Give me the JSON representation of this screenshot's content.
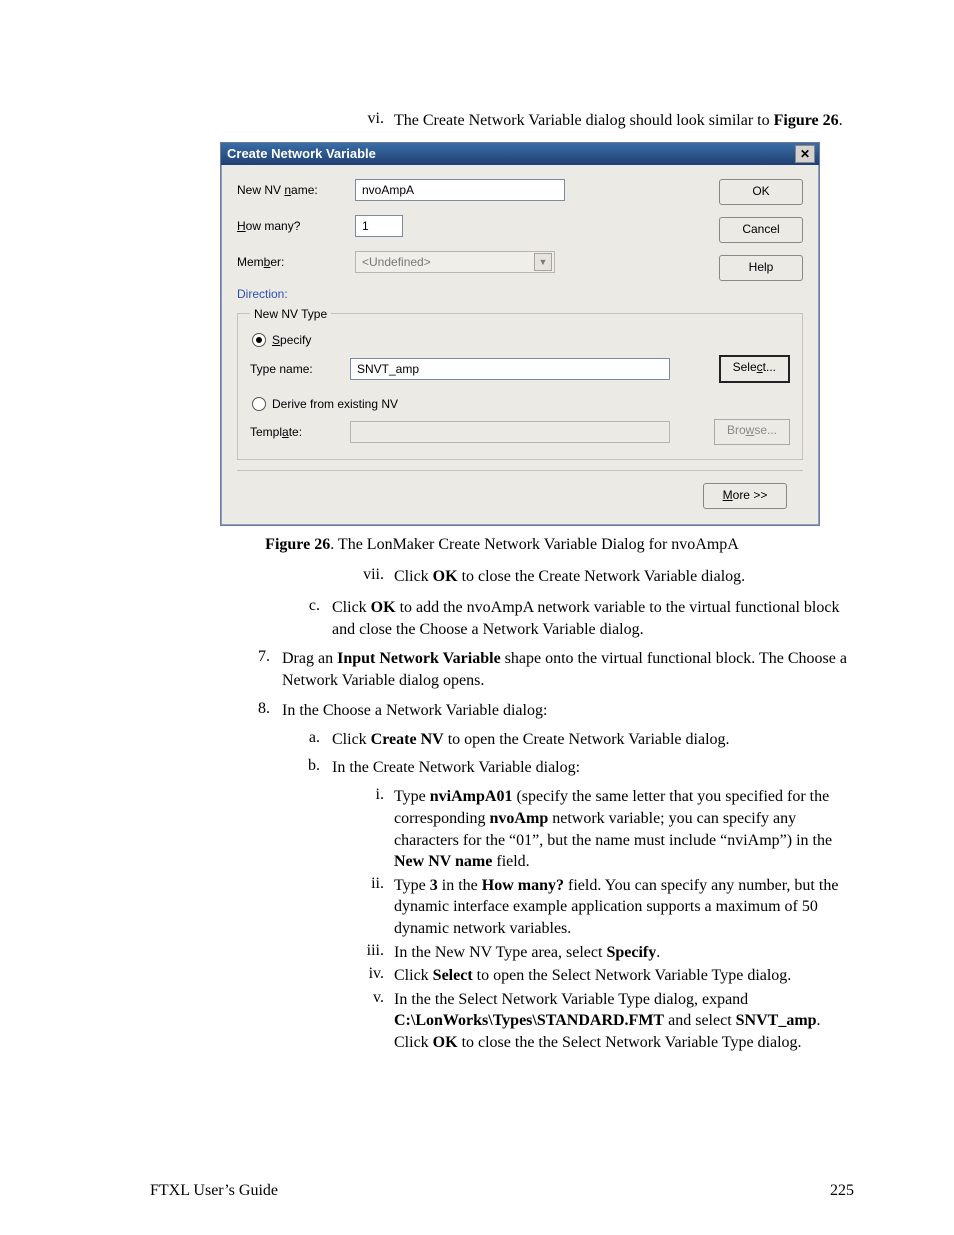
{
  "intro_vi": {
    "marker": "vi.",
    "text_a": "The Create Network Variable dialog should look similar to ",
    "fig_ref": "Figure 26",
    "period": "."
  },
  "dialog": {
    "title": "Create Network Variable",
    "labels": {
      "new_nv_name": "New NV name:",
      "how_many": "How many?",
      "member": "Member:",
      "direction": "Direction:",
      "type_name": "Type name:",
      "template": "Template:",
      "specify": "Specify",
      "derive": "Derive from existing NV",
      "group": "New NV Type"
    },
    "values": {
      "name": "nvoAmpA",
      "count": "1",
      "member": "<Undefined>",
      "type": "SNVT_amp",
      "template": ""
    },
    "buttons": {
      "ok": "OK",
      "cancel": "Cancel",
      "help": "Help",
      "select": "Select...",
      "browse": "Browse...",
      "more": "More >>"
    }
  },
  "mnemonics": {
    "n": "n",
    "H": "H",
    "b": "b",
    "S": "S",
    "a": "a",
    "c": "c",
    "w": "w",
    "M": "M"
  },
  "caption": {
    "fig": "Figure 26",
    "rest": ". The LonMaker Create Network Variable Dialog for nvoAmpA"
  },
  "vii": {
    "marker": "vii.",
    "t1": "Click ",
    "b1": "OK",
    "t2": " to close the Create Network Variable dialog."
  },
  "c": {
    "marker": "c.",
    "t1": "Click ",
    "b1": "OK",
    "t2": " to add the nvoAmpA network variable to the virtual functional block and close the Choose a Network Variable dialog."
  },
  "s7": {
    "marker": "7.",
    "t1": "Drag an ",
    "b1": "Input Network Variable",
    "t2": " shape onto the virtual functional block. The Choose a Network Variable dialog opens."
  },
  "s8": {
    "marker": "8.",
    "t1": "In the Choose a Network Variable dialog:"
  },
  "s8a": {
    "marker": "a.",
    "t1": "Click ",
    "b1": "Create NV",
    "t2": " to open the Create Network Variable dialog."
  },
  "s8b": {
    "marker": "b.",
    "t1": "In the Create Network Variable dialog:"
  },
  "bi": {
    "marker": "i.",
    "t1": "Type ",
    "b1": "nviAmpA01",
    "t2": " (specify the same letter that you specified for the corresponding ",
    "b2": "nvoAmp",
    "t3": " network variable; you can specify any characters for the “01”, but the name must include “nviAmp”) in the ",
    "b3": "New NV name",
    "t4": " field."
  },
  "bii": {
    "marker": "ii.",
    "t1": "Type ",
    "b1": "3",
    "t2": " in the ",
    "b2": "How many?",
    "t3": " field.  You can specify any number, but the dynamic interface example application supports a maximum of 50 dynamic network variables."
  },
  "biii": {
    "marker": "iii.",
    "t1": "In the New NV Type area, select ",
    "b1": "Specify",
    "t2": "."
  },
  "biv": {
    "marker": "iv.",
    "t1": "Click ",
    "b1": "Select",
    "t2": " to open the Select Network Variable Type dialog."
  },
  "bv": {
    "marker": "v.",
    "t1": "In the the Select Network Variable Type dialog, expand ",
    "b1": "C:\\LonWorks\\Types\\STANDARD.FMT",
    "t2": " and select ",
    "b2": "SNVT_amp",
    "t3": ".  Click ",
    "b3": "OK",
    "t4": " to close the the Select Network Variable Type dialog."
  },
  "footer": {
    "left": "FTXL User’s Guide",
    "right": "225"
  }
}
